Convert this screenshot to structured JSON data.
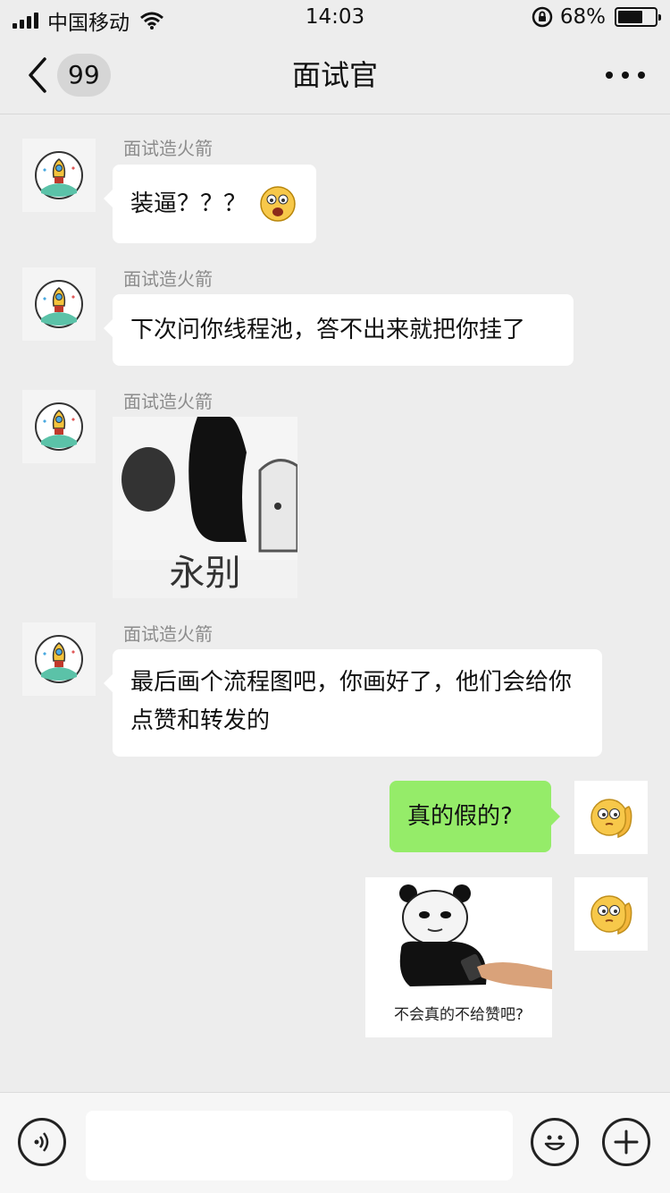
{
  "status_bar": {
    "carrier": "中国移动",
    "time": "14:03",
    "battery": "68%",
    "battery_level": 0.68
  },
  "header": {
    "unread_count": "99",
    "title": "面试官"
  },
  "messages": [
    {
      "sender": "面试造火箭",
      "text": "装逼？？？"
    },
    {
      "sender": "面试造火箭",
      "text": "下次问你线程池，答不出来就把你挂了"
    },
    {
      "sender": "面试造火箭",
      "sticker_caption": "永别"
    },
    {
      "sender": "面试造火箭",
      "text": "最后画个流程图吧，你画好了，他们会给你点赞和转发的"
    },
    {
      "text": "真的假的?"
    },
    {
      "sticker_caption": "不会真的不给赞吧?"
    }
  ],
  "input_bar": {
    "placeholder": ""
  },
  "colors": {
    "background": "#ededed",
    "self_bubble": "#95ec69",
    "other_bubble": "#ffffff",
    "sender_name": "#8c8c8c"
  },
  "icons": [
    "back-chevron-icon",
    "more-dots-icon",
    "rocket-avatar-icon",
    "thinking-emoji-avatar-icon",
    "voice-icon",
    "emoji-icon",
    "plus-icon",
    "surprised-emoji-icon"
  ]
}
